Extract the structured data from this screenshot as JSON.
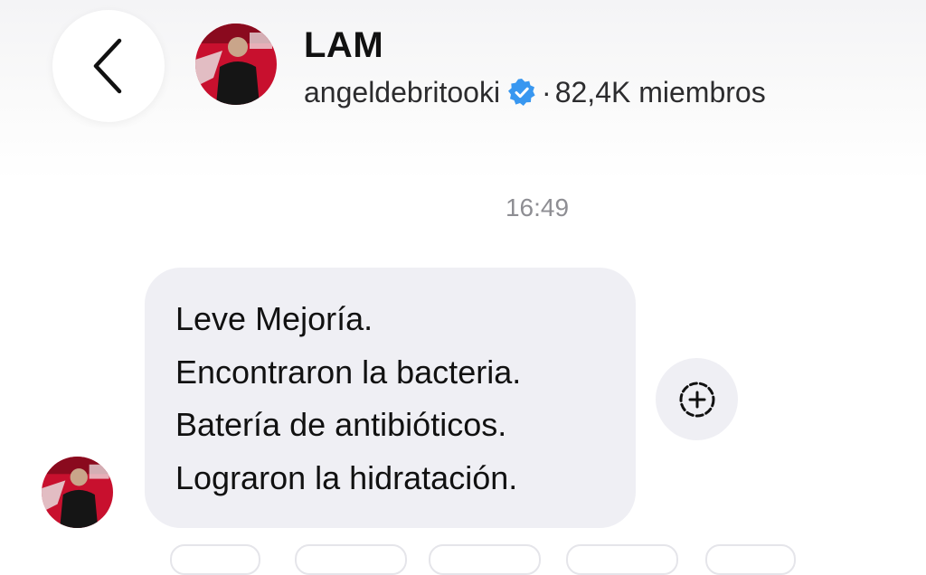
{
  "header": {
    "back_icon": "chevron-left-icon",
    "channel_name": "LAM",
    "handle": "angeldebritooki",
    "verified_icon": "verified-badge-icon",
    "separator": "·",
    "members": "82,4K miembros"
  },
  "chat": {
    "timestamp": "16:49",
    "message_lines": [
      "Leve Mejoría.",
      "Encontraron la bacteria.",
      "Batería de antibióticos.",
      "Lograron la hidratación."
    ],
    "add_reaction_icon": "add-reaction-icon"
  },
  "colors": {
    "bubble": "#efeff4",
    "verified": "#3897f0",
    "timestamp": "#8e8e93",
    "avatar_background": "#c8102e"
  }
}
